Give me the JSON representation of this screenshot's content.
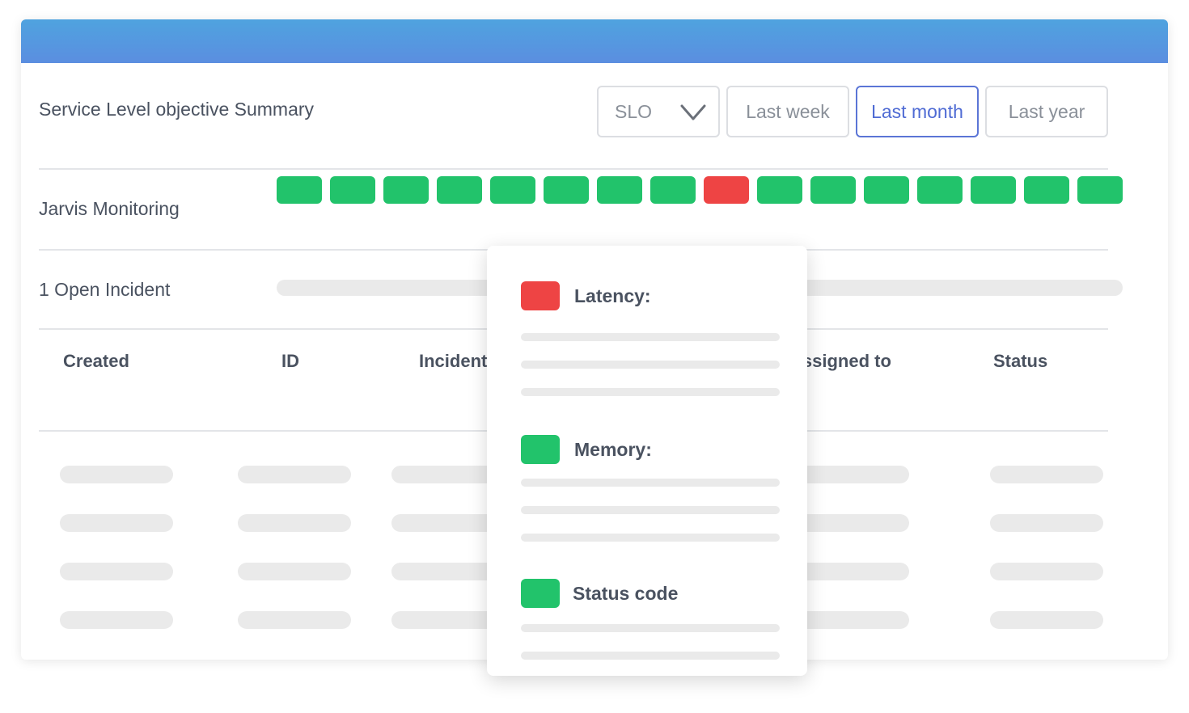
{
  "summary": {
    "title": "Service Level objective Summary"
  },
  "filters": {
    "select_value": "SLO",
    "buttons": [
      "Last week",
      "Last month",
      "Last year"
    ],
    "active": "Last month"
  },
  "monitor": {
    "label": "Jarvis Monitoring",
    "statuses": [
      "ok",
      "ok",
      "ok",
      "ok",
      "ok",
      "ok",
      "ok",
      "ok",
      "fail",
      "ok",
      "ok",
      "ok",
      "ok",
      "ok",
      "ok",
      "ok"
    ]
  },
  "incidents": {
    "label": "1 Open Incident"
  },
  "table": {
    "headers": [
      "Created",
      "ID",
      "Incident",
      "Assigned to",
      "Status"
    ]
  },
  "popup": {
    "items": [
      {
        "label": "Latency:",
        "status": "fail"
      },
      {
        "label": "Memory:",
        "status": "ok"
      },
      {
        "label": "Status code",
        "status": "ok"
      }
    ]
  },
  "colors": {
    "ok": "#22c36b",
    "fail": "#ee4444",
    "accent": "#4f6bd4",
    "header_gradient_top": "#4fa3df",
    "header_gradient_bottom": "#5b8ee0"
  },
  "icons": {
    "select_chevron": "chevron-down-icon"
  }
}
